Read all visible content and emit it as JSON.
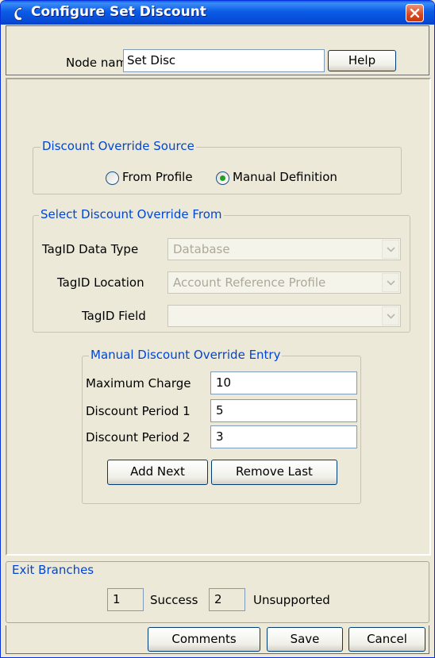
{
  "window": {
    "title": "Configure Set Discount",
    "title_icon": "phone-handset-icon",
    "close_icon": "close-icon"
  },
  "node": {
    "label": "Node name",
    "value": "Set Disc",
    "help_label": "Help"
  },
  "override_source": {
    "legend": "Discount Override Source",
    "options": [
      {
        "label": "From Profile",
        "selected": false
      },
      {
        "label": "Manual Definition",
        "selected": true
      }
    ]
  },
  "select_from": {
    "legend": "Select Discount Override From",
    "fields": [
      {
        "label": "TagID Data Type",
        "value": "Database"
      },
      {
        "label": "TagID Location",
        "value": "Account Reference Profile"
      },
      {
        "label": "TagID Field",
        "value": ""
      }
    ]
  },
  "manual_entry": {
    "legend": "Manual Discount Override Entry",
    "rows": [
      {
        "label": "Maximum Charge",
        "value": "10"
      },
      {
        "label": "Discount Period 1",
        "value": "5"
      },
      {
        "label": "Discount Period 2",
        "value": "3"
      }
    ],
    "add_label": "Add Next",
    "remove_label": "Remove Last"
  },
  "exit_branches": {
    "legend": "Exit Branches",
    "branches": [
      {
        "number": "1",
        "name": "Success"
      },
      {
        "number": "2",
        "name": "Unsupported"
      }
    ]
  },
  "footer": {
    "comments_label": "Comments",
    "save_label": "Save",
    "cancel_label": "Cancel"
  },
  "colors": {
    "titlebar": "#0b5ce6",
    "legend_text": "#0046d5",
    "dialog_bg": "#ece9d8",
    "close_button": "#d5461f"
  }
}
